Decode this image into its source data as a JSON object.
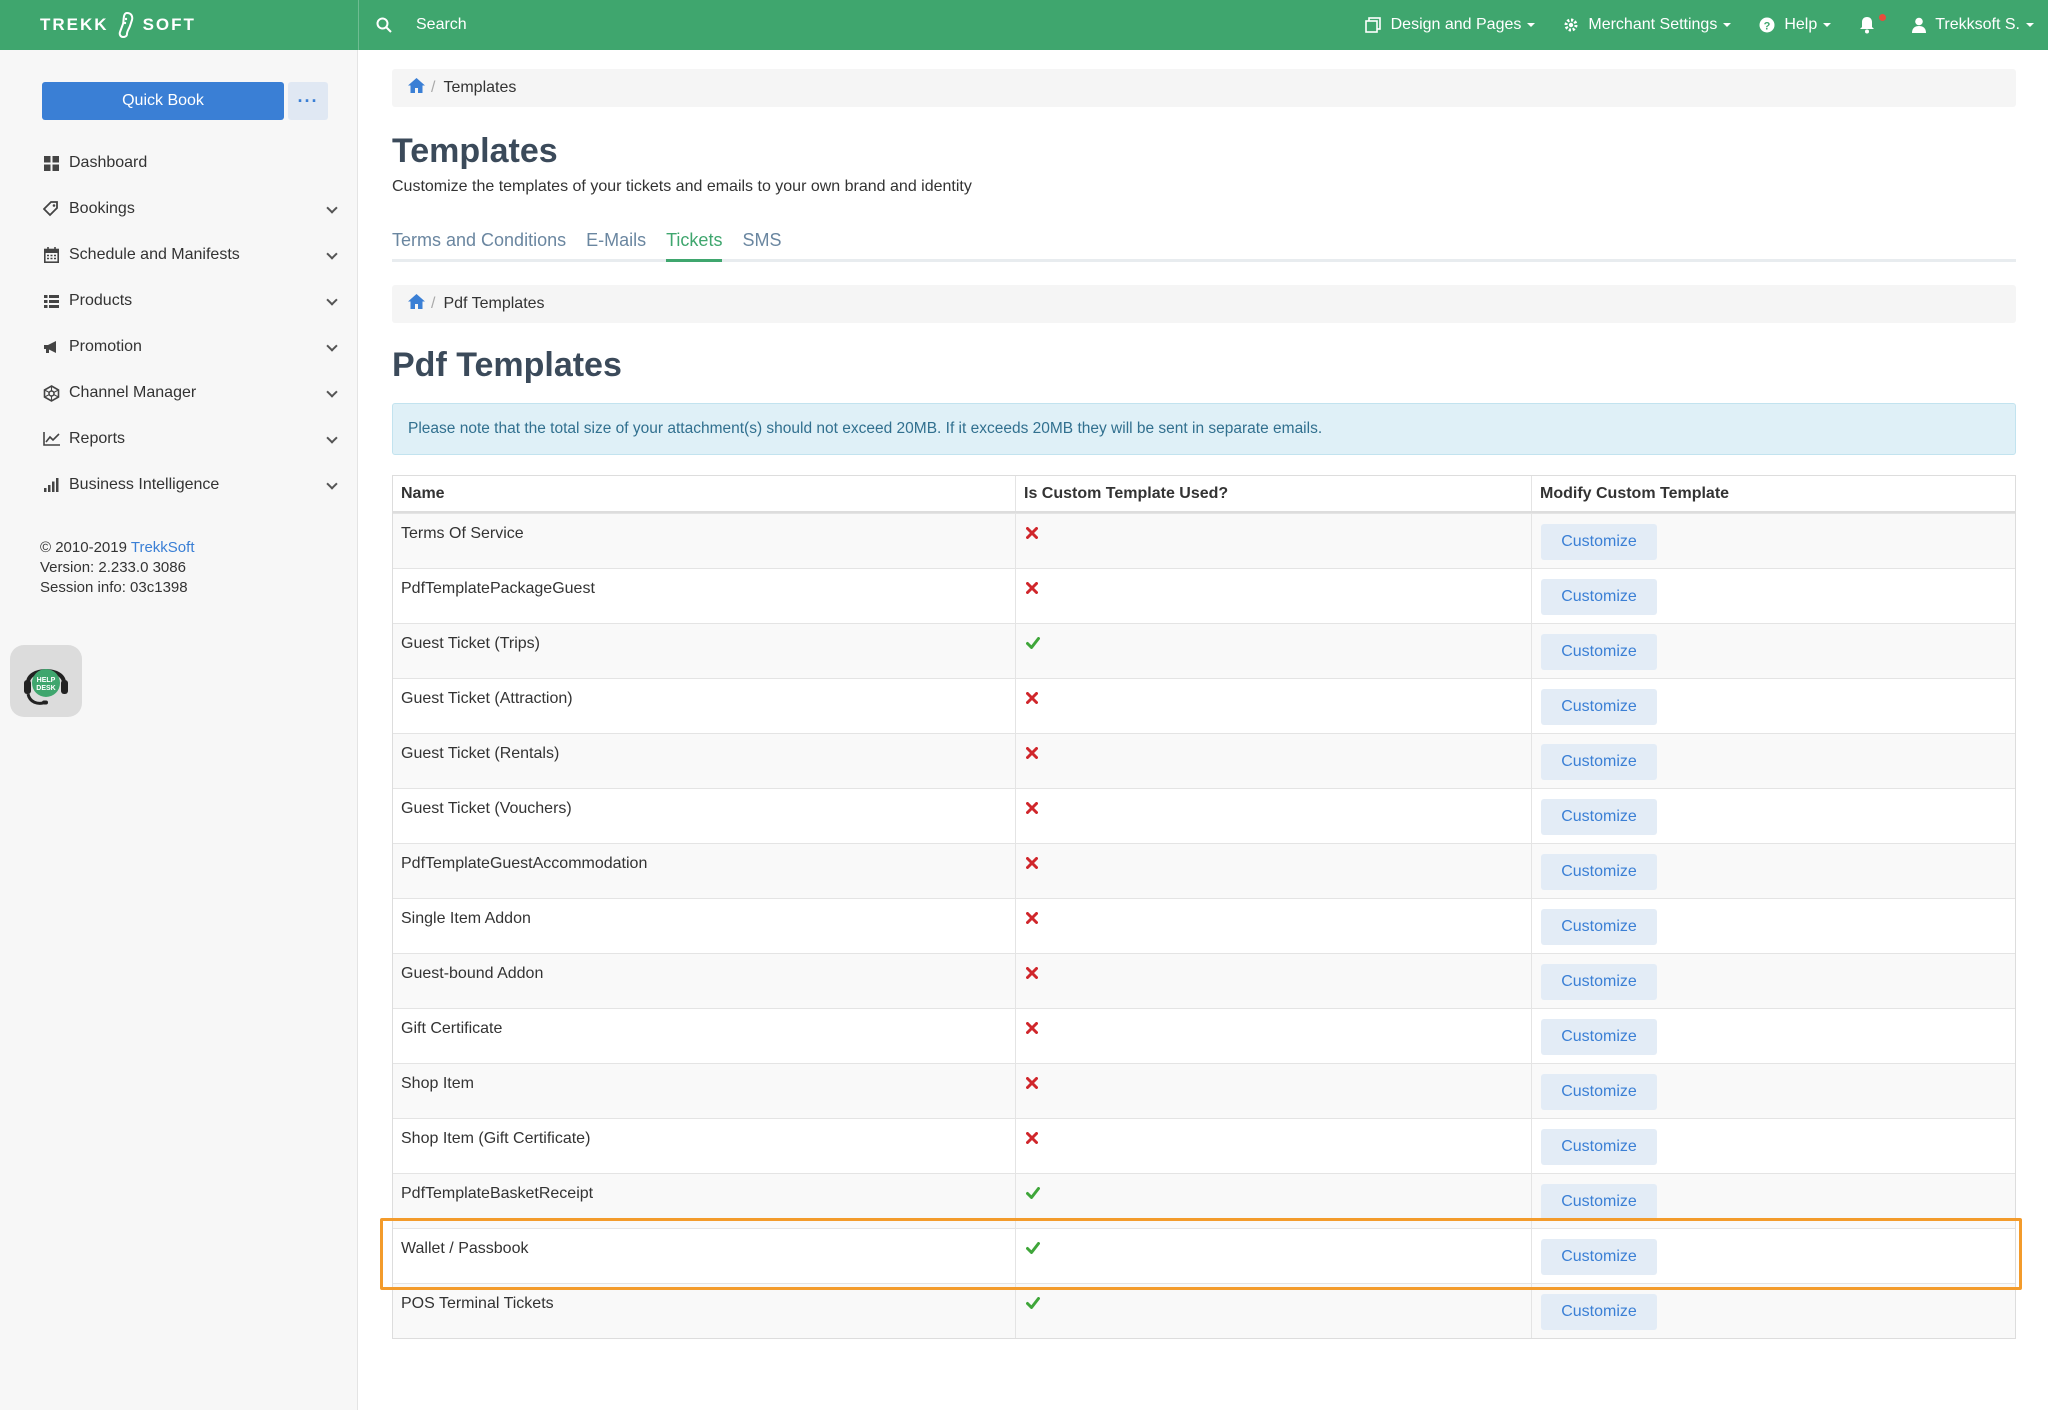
{
  "topbar": {
    "logo_left": "TREKK",
    "logo_right": "SOFT",
    "search_label": "Search",
    "nav": [
      {
        "label": "Design and Pages",
        "icon": "pages-icon"
      },
      {
        "label": "Merchant Settings",
        "icon": "gear-icon"
      },
      {
        "label": "Help",
        "icon": "help-icon"
      }
    ],
    "user_label": "Trekksoft S."
  },
  "sidebar": {
    "quick_book": "Quick Book",
    "more": "···",
    "items": [
      {
        "label": "Dashboard",
        "icon": "dashboard-icon"
      },
      {
        "label": "Bookings",
        "icon": "tag-icon"
      },
      {
        "label": "Schedule and Manifests",
        "icon": "calendar-icon"
      },
      {
        "label": "Products",
        "icon": "list-icon"
      },
      {
        "label": "Promotion",
        "icon": "megaphone-icon"
      },
      {
        "label": "Channel Manager",
        "icon": "network-icon"
      },
      {
        "label": "Reports",
        "icon": "line-chart-icon"
      },
      {
        "label": "Business Intelligence",
        "icon": "bar-chart-icon"
      }
    ],
    "copyright": "© 2010-2019 ",
    "company_link": "TrekkSoft",
    "version": "Version: 2.233.0 3086",
    "session": "Session info: 03c1398",
    "helpdesk_line1": "HELP",
    "helpdesk_line2": "DESK"
  },
  "breadcrumb": {
    "current": "Templates"
  },
  "page": {
    "title": "Templates",
    "subtitle": "Customize the templates of your tickets and emails to your own brand and identity"
  },
  "tabs": [
    {
      "label": "Terms and Conditions",
      "active": false
    },
    {
      "label": "E-Mails",
      "active": false
    },
    {
      "label": "Tickets",
      "active": true
    },
    {
      "label": "SMS",
      "active": false
    }
  ],
  "sub_breadcrumb": {
    "current": "Pdf Templates"
  },
  "section": {
    "title": "Pdf Templates",
    "alert": "Please note that the total size of your attachment(s) should not exceed 20MB. If it exceeds 20MB they will be sent in separate emails."
  },
  "table": {
    "headers": [
      "Name",
      "Is Custom Template Used?",
      "Modify Custom Template"
    ],
    "button_label": "Customize",
    "rows": [
      {
        "name": "Terms Of Service",
        "used": false
      },
      {
        "name": "PdfTemplatePackageGuest",
        "used": false
      },
      {
        "name": "Guest Ticket (Trips)",
        "used": true
      },
      {
        "name": "Guest Ticket (Attraction)",
        "used": false
      },
      {
        "name": "Guest Ticket (Rentals)",
        "used": false
      },
      {
        "name": "Guest Ticket (Vouchers)",
        "used": false
      },
      {
        "name": "PdfTemplateGuestAccommodation",
        "used": false
      },
      {
        "name": "Single Item Addon",
        "used": false
      },
      {
        "name": "Guest-bound Addon",
        "used": false
      },
      {
        "name": "Gift Certificate",
        "used": false
      },
      {
        "name": "Shop Item",
        "used": false
      },
      {
        "name": "Shop Item (Gift Certificate)",
        "used": false
      },
      {
        "name": "PdfTemplateBasketReceipt",
        "used": true
      },
      {
        "name": "Wallet / Passbook",
        "used": true
      },
      {
        "name": "POS Terminal Tickets",
        "used": true
      }
    ]
  },
  "colors": {
    "brand_green": "#3fa66e",
    "link_blue": "#3a7fd5",
    "cross_red": "#d0262b",
    "check_green": "#3fa63a",
    "highlight_orange": "#f39b2b"
  }
}
